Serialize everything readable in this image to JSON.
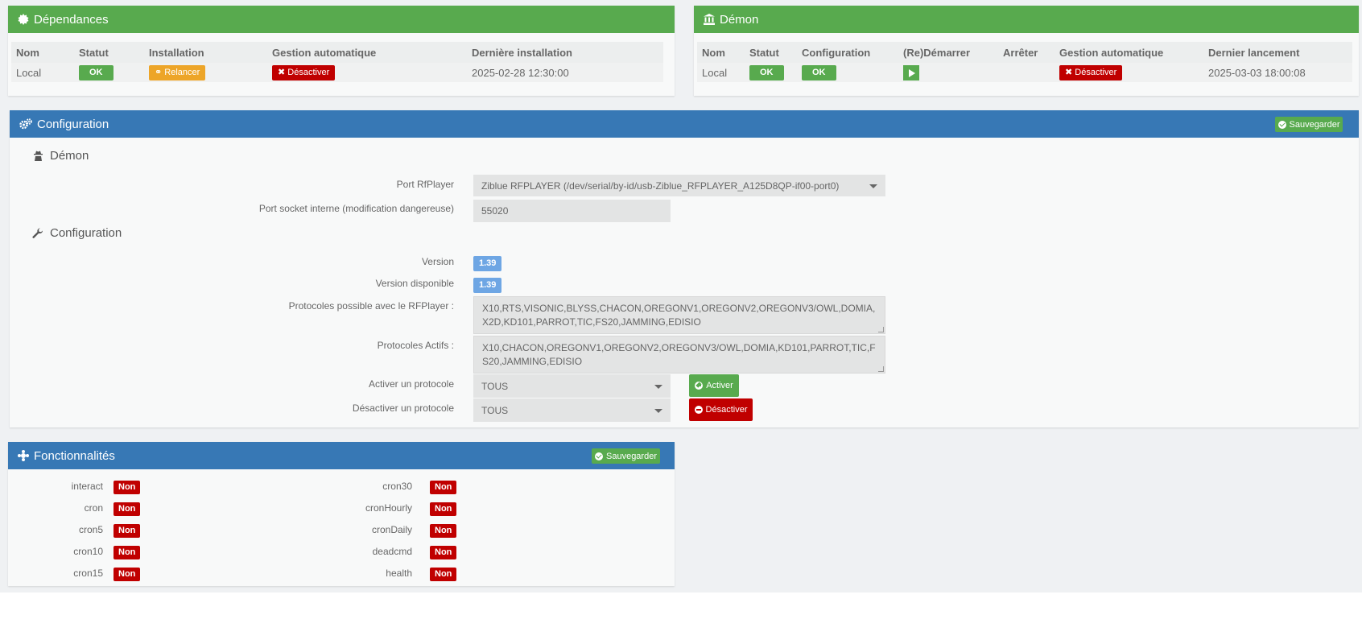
{
  "dependances": {
    "title": "Dépendances",
    "headers": [
      "Nom",
      "Statut",
      "Installation",
      "Gestion automatique",
      "Dernière installation"
    ],
    "row": {
      "nom": "Local",
      "statut": "OK",
      "installation": "Relancer",
      "gestion": "Désactiver",
      "derniere": "2025-02-28 12:30:00"
    }
  },
  "demon": {
    "title": "Démon",
    "headers": [
      "Nom",
      "Statut",
      "Configuration",
      "(Re)Démarrer",
      "Arrêter",
      "Gestion automatique",
      "Dernier lancement"
    ],
    "row": {
      "nom": "Local",
      "statut": "OK",
      "configuration": "OK",
      "gestion": "Désactiver",
      "dernier": "2025-03-03 18:00:08"
    }
  },
  "configuration": {
    "title": "Configuration",
    "save_label": "Sauvegarder",
    "section_demon": "Démon",
    "port_label": "Port RfPlayer",
    "port_value": "Ziblue RFPLAYER (/dev/serial/by-id/usb-Ziblue_RFPLAYER_A125D8QP-if00-port0)",
    "socket_label": "Port socket interne (modification dangereuse)",
    "socket_value": "55020",
    "section_config": "Configuration",
    "version_label": "Version",
    "version_value": "1.39",
    "version_dispo_label": "Version disponible",
    "version_dispo_value": "1.39",
    "protocoles_possibles_label": "Protocoles possible avec le RFPlayer :",
    "protocoles_possibles_value": "X10,RTS,VISONIC,BLYSS,CHACON,OREGONV1,OREGONV2,OREGONV3/OWL,DOMIA,X2D,KD101,PARROT,TIC,FS20,JAMMING,EDISIO",
    "protocoles_actifs_label": "Protocoles Actifs :",
    "protocoles_actifs_value": "X10,CHACON,OREGONV1,OREGONV2,OREGONV3/OWL,DOMIA,KD101,PARROT,TIC,FS20,JAMMING,EDISIO",
    "activer_label": "Activer un protocole",
    "activer_value": "TOUS",
    "activer_button": "Activer",
    "desactiver_label": "Désactiver un protocole",
    "desactiver_value": "TOUS",
    "desactiver_button": "Désactiver"
  },
  "fonctionnalites": {
    "title": "Fonctionnalités",
    "save_label": "Sauvegarder",
    "left": [
      {
        "name": "interact",
        "value": "Non"
      },
      {
        "name": "cron",
        "value": "Non"
      },
      {
        "name": "cron5",
        "value": "Non"
      },
      {
        "name": "cron10",
        "value": "Non"
      },
      {
        "name": "cron15",
        "value": "Non"
      }
    ],
    "right": [
      {
        "name": "cron30",
        "value": "Non"
      },
      {
        "name": "cronHourly",
        "value": "Non"
      },
      {
        "name": "cronDaily",
        "value": "Non"
      },
      {
        "name": "deadcmd",
        "value": "Non"
      },
      {
        "name": "health",
        "value": "Non"
      }
    ]
  },
  "colors": {
    "green": "#58aa4e",
    "blue": "#3778b5",
    "red": "#c00000",
    "orange": "#eda528",
    "info": "#6ea6e4"
  }
}
